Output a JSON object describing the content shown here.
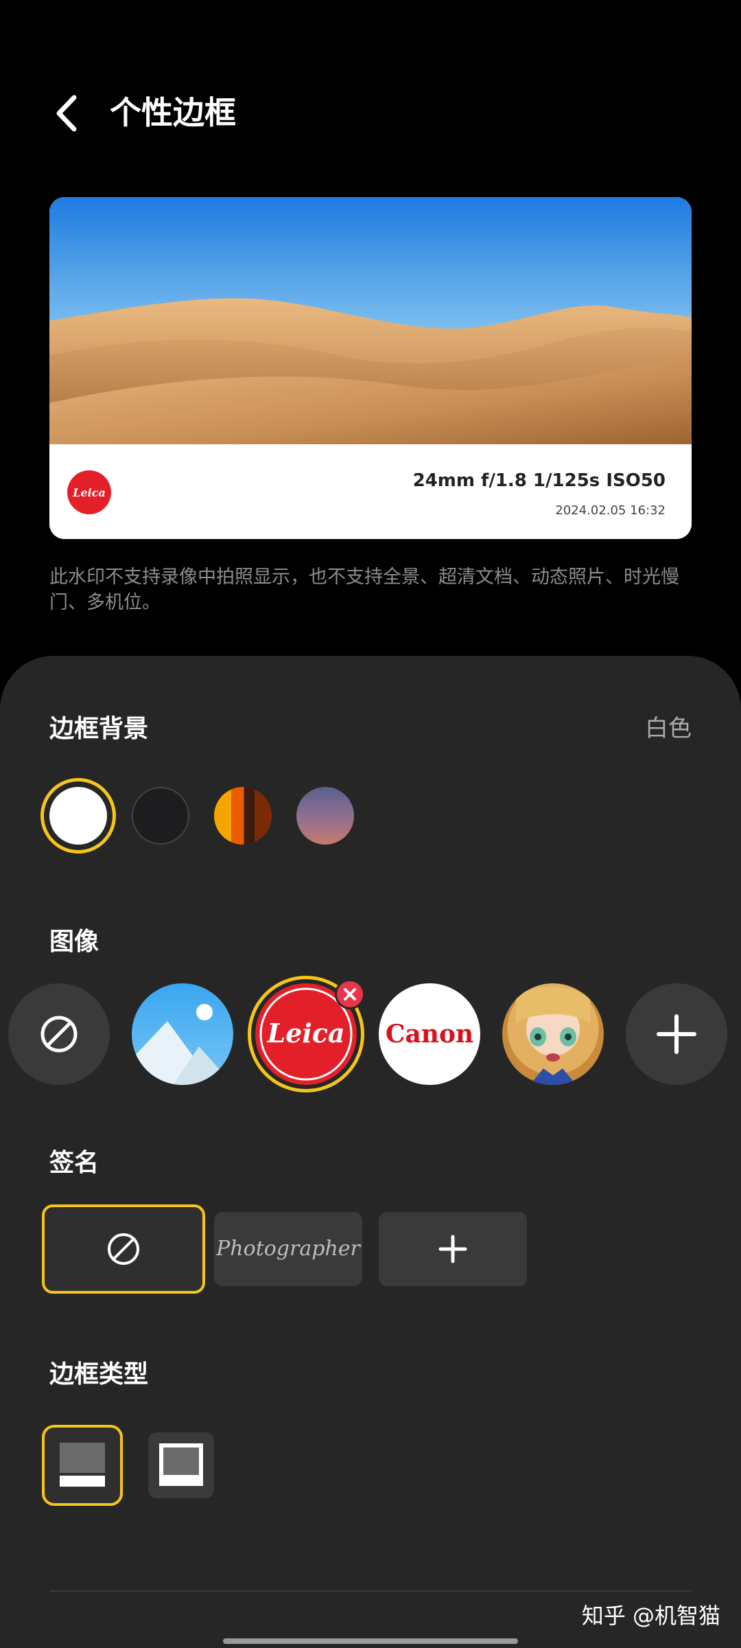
{
  "header": {
    "title": "个性边框",
    "back_icon": "chevron-left-icon"
  },
  "preview": {
    "exif": "24mm f/1.8 1/125s ISO50",
    "date": "2024.02.05 16:32",
    "brand_badge": "Leica"
  },
  "notice": "此水印不支持录像中拍照显示，也不支持全景、超清文档、动态照片、时光慢门、多机位。",
  "sections": {
    "background": {
      "label": "边框背景",
      "value": "白色"
    },
    "image": {
      "label": "图像",
      "canon_text": "Canon",
      "leica_text": "Leica"
    },
    "signature": {
      "label": "签名",
      "sample": "Photographer"
    },
    "frame_type": {
      "label": "边框类型"
    }
  },
  "colors": {
    "accent": "#f5c518",
    "panel": "#262626",
    "leica_red": "#e3202a"
  },
  "watermark": "知乎 @机智猫"
}
